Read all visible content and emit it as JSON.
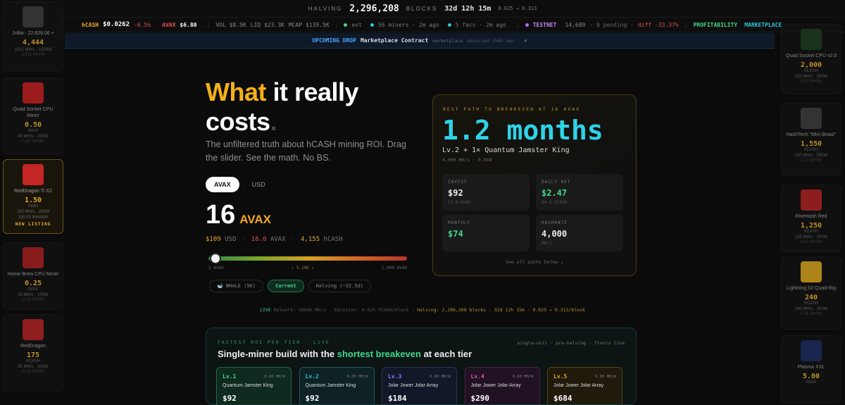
{
  "halving": {
    "label": "HALVING",
    "blocks": "2,296,208",
    "blocks_unit": "BLOCKS",
    "countdown": "32d 12h 15m",
    "rate": "0.625 → 0.313"
  },
  "ticker": {
    "hcash_label": "hCASH",
    "hcash_price": "$0.0262",
    "hcash_change": "-6.5%",
    "avax_label": "AVAX",
    "avax_price": "$6.80",
    "vol": "VOL $8.5K",
    "liq": "LIQ $23.3K",
    "mcap": "MCAP $139.5K",
    "est": "est",
    "miners": "56 miners · 2m ago",
    "facs": "5 facs · 2m ago",
    "testnet_label": "TESTNET",
    "testnet_val": "14,689",
    "pending": "· 0 pending ·",
    "diff": "diff -33.37%",
    "profitability": "PROFITABILITY",
    "marketplace": "MARKETPLACE"
  },
  "banner": {
    "tag": "UPCOMING DROP",
    "title": "Marketplace Contract",
    "source": "marketplace",
    "detected": "detected 256h ago",
    "close": "✕"
  },
  "left_rail": [
    {
      "name": "Jolita - 22.628.06 +",
      "price": "4,444",
      "unit": "",
      "spec": "1012 MH/s · 1500W",
      "spec2": "0.411 MH/W",
      "color": "#3a3a3a",
      "icon": "cpu-icon",
      "active": false,
      "new": ""
    },
    {
      "name": "Quad Socket CPU Miner",
      "price": "0.50",
      "unit": "AVAX",
      "spec": "40 MH/s · 200W",
      "spec2": "0.20 MH/W",
      "color": "#b32020",
      "icon": "cpu-icon",
      "active": false,
      "new": ""
    },
    {
      "name": "RedDragon Ti X2",
      "price": "1.50",
      "unit": "AVAX",
      "spec": "150 MH/s · 200W",
      "spec2": "150.00 MH/kWh",
      "color": "#c42525",
      "icon": "gpu-icon",
      "active": true,
      "new": "NEW LISTING"
    },
    {
      "name": "Home Brew CPU Miner",
      "price": "0.25",
      "unit": "AVAX",
      "spec": "25 MH/s · 100W",
      "spec2": "0.25 MH/W",
      "color": "#9e2020",
      "icon": "cpu-icon",
      "active": false,
      "new": ""
    },
    {
      "name": "RedDragon",
      "price": "175",
      "unit": "hCASH",
      "spec": "85 MH/s · 200W",
      "spec2": "0.43 MH/W",
      "color": "#a82222",
      "icon": "gpu-icon",
      "active": false,
      "new": ""
    }
  ],
  "right_rail": [
    {
      "name": "Quad Socket CPU v2.0",
      "price": "2,000",
      "unit": "hCASH",
      "spec": "120 MH/s · 200W",
      "spec2": "0.60 MH/W",
      "color": "#1d3a1d",
      "icon": "cpu-icon"
    },
    {
      "name": "HashTech \"Mini Beast\"",
      "price": "1,550",
      "unit": "hCASH",
      "spec": "110 MH/s · 500W",
      "spec2": "0.22 MH/W",
      "color": "#3a3a3a",
      "icon": "server-icon"
    },
    {
      "name": "RiseHash Red",
      "price": "1,250",
      "unit": "hCASH",
      "spec": "125 MH/s · 250W",
      "spec2": "0.50 MH/W",
      "color": "#a62222",
      "icon": "gpu-icon"
    },
    {
      "name": "Lightning 02 Quad-Rig",
      "price": "240",
      "unit": "hCASH",
      "spec": "140 MH/s · 400W",
      "spec2": "0.35 MH/W",
      "color": "#c99a1c",
      "icon": "rig-icon"
    },
    {
      "name": "Plasma XXL",
      "price": "5.00",
      "unit": "AVAX",
      "spec": "",
      "spec2": "",
      "color": "#1c2a5a",
      "icon": "chip-icon"
    }
  ],
  "hero": {
    "title_a": "What",
    "title_b": " it really costs",
    "title_dot": ".",
    "subtitle": "The unfiltered truth about hCASH mining ROI. Drag the slider. See the math. No BS."
  },
  "currency": {
    "active": "AVAX",
    "other": "USD"
  },
  "amount": {
    "value": "16",
    "unit": "AVAX"
  },
  "conv": {
    "usd": "$109",
    "usd_unit": "USD",
    "avax": "16.0",
    "avax_unit": "AVAX",
    "hcash": "4,155",
    "hcash_unit": "hCASH",
    "sep": "·"
  },
  "slider": {
    "min": "2 AVAX",
    "mid": "↓ 5.10K ↓",
    "max": "1,000 AVAX",
    "position": 0.014
  },
  "presets": [
    "🐋 WHALE (5K)",
    "Current",
    "Halving (~32.5d)"
  ],
  "breakeven": {
    "label": "BEST PATH TO BREAKEVEN AT 16 AVAX",
    "value": "1.2 months",
    "build": "Lv.2 + 1× Quantum Jamster King",
    "build_spec": "4,000 MH/s · 0.0kW",
    "stats": [
      {
        "label": "INVEST",
        "value": "$92",
        "sub": "13.6 AVAX",
        "color": "#eeeeee"
      },
      {
        "label": "DAILY NET",
        "value": "$2.47",
        "sub": "94.3 hCASH",
        "color": "#3fd98c"
      },
      {
        "label": "MONTHLY",
        "value": "$74",
        "sub": "",
        "color": "#3fd98c"
      },
      {
        "label": "HASHRATE",
        "value": "4,000",
        "sub": "MH/s",
        "color": "#eeeeee"
      }
    ],
    "see_all": "See all paths below ↓"
  },
  "network": {
    "live": "LIVE",
    "text": "Network: 1869k MH/s · Emission: 0.625 hCASH/block ·",
    "halving": "Halving: 2,296,208 blocks · 32d 12h 15m · 0.625 → 0.313/block"
  },
  "tiers": {
    "heading_small": "FASTEST ROI PER TIER · LIVE",
    "heading_a": "Single-miner build with the ",
    "heading_g": "shortest breakeven",
    "heading_b": " at each tier",
    "tags": "single-unit · pre-halving · floors live",
    "cards": [
      {
        "lv": "Lv.1",
        "mh": "0.00 MH/W",
        "name": "Quantum Jamster King",
        "price": "$92",
        "color": "#3fd98c",
        "bg": "#0f2a1e",
        "border": "#1f6a48"
      },
      {
        "lv": "Lv.2",
        "mh": "0.00 MH/W",
        "name": "Quantum Jamster King",
        "price": "$92",
        "color": "#2ec6d6",
        "bg": "#0e2226",
        "border": "#1d5a62"
      },
      {
        "lv": "Lv.3",
        "mh": "0.00 MH/W",
        "name": "Jolar Jower Jolar Array",
        "price": "$184",
        "color": "#6a8cff",
        "bg": "#121828",
        "border": "#26345e"
      },
      {
        "lv": "Lv.4",
        "mh": "0.00 MH/W",
        "name": "Jolar Jower Jolar Array",
        "price": "$290",
        "color": "#e05aa8",
        "bg": "#201222",
        "border": "#4a2240"
      },
      {
        "lv": "Lv.5",
        "mh": "0.00 MH/W",
        "name": "Jolar Jower Jolar Array",
        "price": "$684",
        "color": "#e6a72a",
        "bg": "#201a0c",
        "border": "#5a4416"
      }
    ]
  }
}
